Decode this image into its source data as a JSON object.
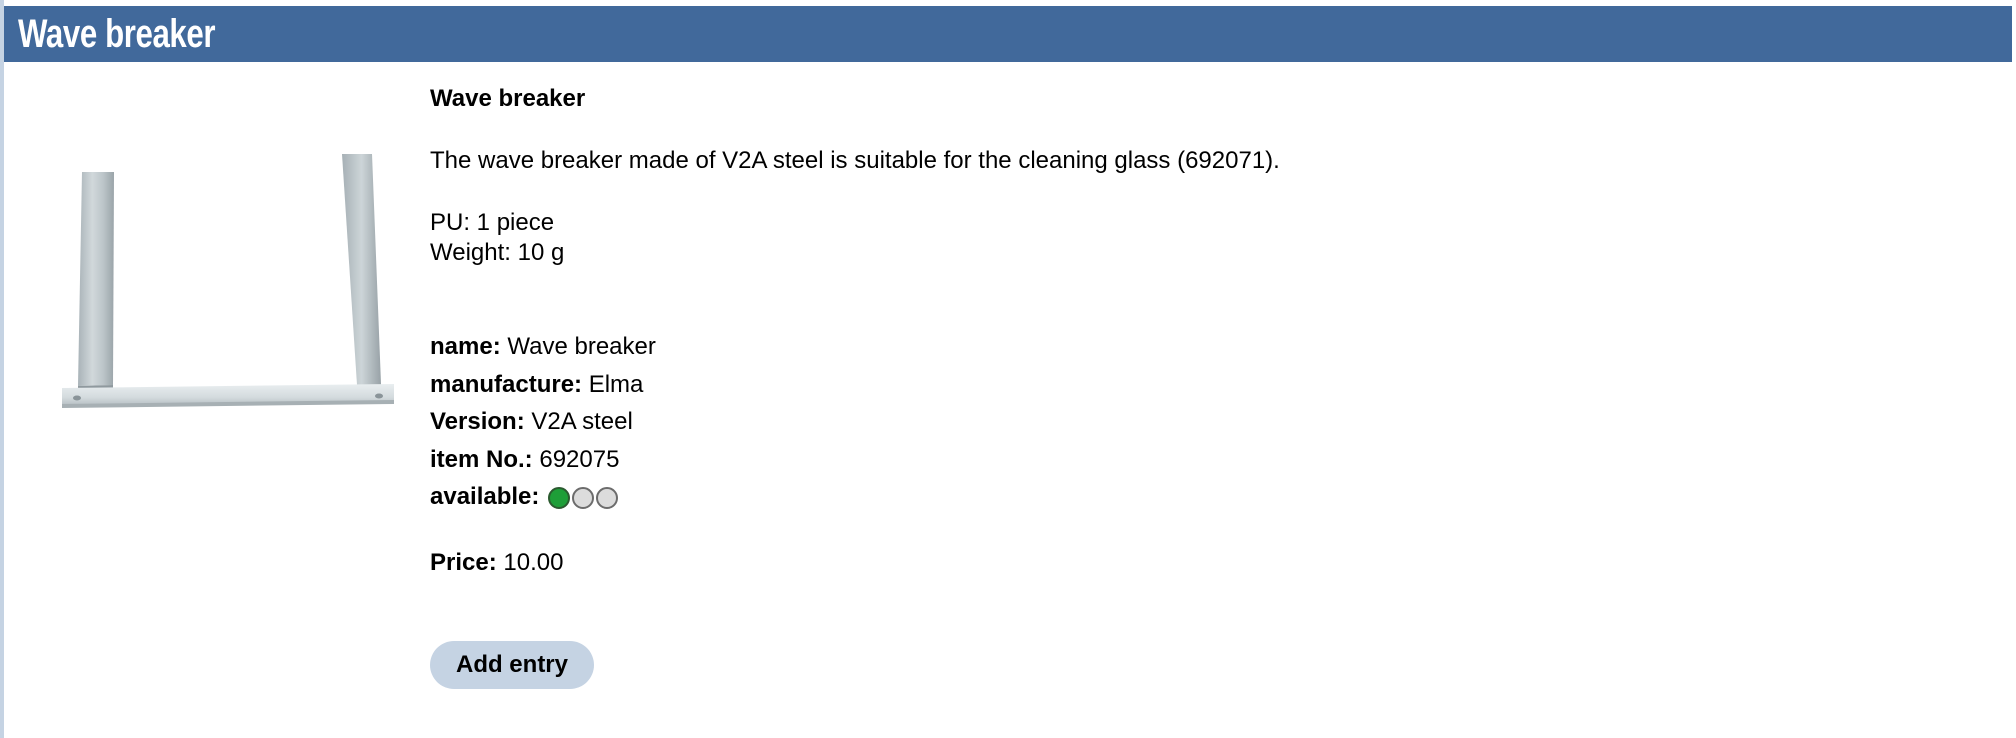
{
  "header": {
    "title": "Wave breaker"
  },
  "product": {
    "image_alt": "Wave breaker",
    "title": "Wave breaker",
    "description": "The wave breaker made of V2A steel is suitable for the cleaning glass (692071).",
    "pu": "PU: 1 piece",
    "weight": "Weight: 10 g",
    "attributes": {
      "name_label": "name:",
      "name_value": "Wave breaker",
      "manufacture_label": "manufacture:",
      "manufacture_value": "Elma",
      "version_label": "Version:",
      "version_value": "V2A steel",
      "item_label": "item No.:",
      "item_value": "692075",
      "available_label": "available:",
      "availability_level": 1,
      "availability_max": 3
    },
    "price_label": "Price:",
    "price_value": "10.00"
  },
  "actions": {
    "add_entry_label": "Add entry"
  },
  "colors": {
    "header_bg": "#41699b",
    "button_bg": "#c5d3e3",
    "available_on": "#1e9e38",
    "available_off": "#dcdcdc"
  }
}
